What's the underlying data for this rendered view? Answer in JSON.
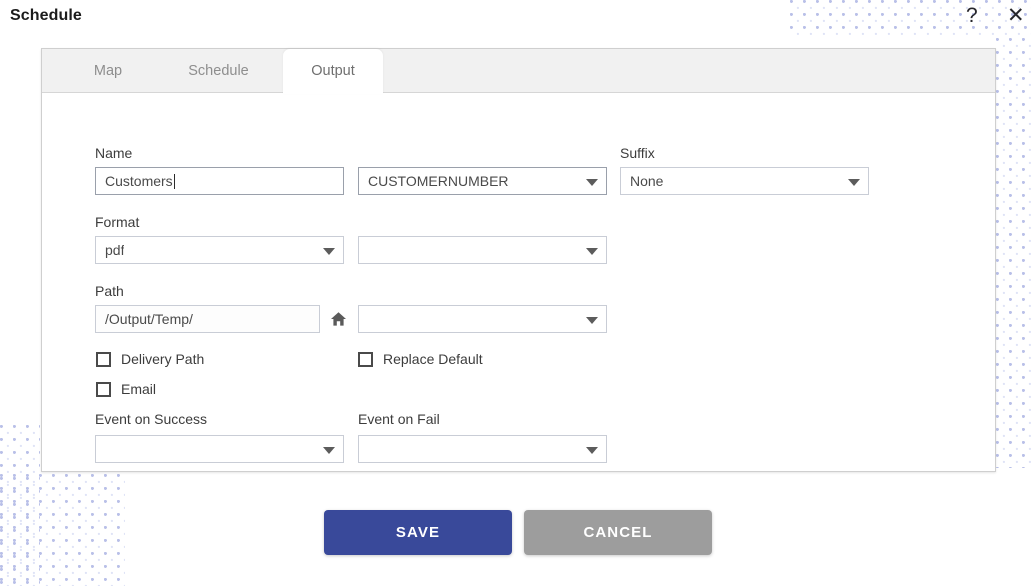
{
  "window": {
    "title": "Schedule",
    "help_icon": "question-mark-icon",
    "close_icon": "close-icon"
  },
  "tabs": [
    {
      "label": "Map",
      "active": false
    },
    {
      "label": "Schedule",
      "active": false
    },
    {
      "label": "Output",
      "active": true
    }
  ],
  "form": {
    "name": {
      "label": "Name",
      "value": "Customers",
      "placeholder": ""
    },
    "field_select": {
      "value": "CUSTOMERNUMBER"
    },
    "suffix": {
      "label": "Suffix",
      "value": "None"
    },
    "format": {
      "label": "Format",
      "value": "pdf"
    },
    "format_secondary": {
      "value": ""
    },
    "path": {
      "label": "Path",
      "value": "/Output/Temp/",
      "home_icon": "home-icon"
    },
    "path_secondary": {
      "value": ""
    },
    "checkboxes": [
      {
        "label": "Delivery Path",
        "checked": false
      },
      {
        "label": "Email",
        "checked": false
      },
      {
        "label": "Replace Default",
        "checked": false
      }
    ],
    "event_on_success": {
      "label": "Event on Success",
      "value": ""
    },
    "event_on_fail": {
      "label": "Event on Fail",
      "value": ""
    }
  },
  "actions": {
    "save_label": "SAVE",
    "cancel_label": "CANCEL"
  },
  "colors": {
    "save_button": "#39499a",
    "cancel_button": "#9d9d9d",
    "pattern_dot": "#b9c0e8",
    "tab_strip": "#f1f1f1"
  }
}
